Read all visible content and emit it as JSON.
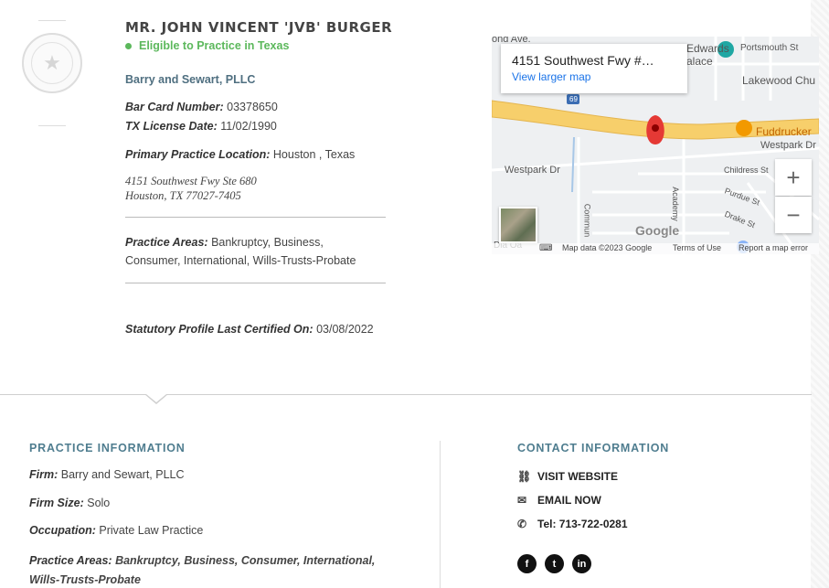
{
  "profile": {
    "name": "MR. JOHN VINCENT 'JVB' BURGER",
    "eligibility": "Eligible to Practice in Texas",
    "firm": "Barry and Sewart, PLLC",
    "bar_card_label": "Bar Card Number:",
    "bar_card_value": "03378650",
    "license_label": "TX License Date:",
    "license_value": "11/02/1990",
    "location_label": "Primary Practice Location:",
    "location_value": "Houston , Texas",
    "address_line1": "4151 Southwest Fwy Ste 680",
    "address_line2": "Houston, TX 77027-7405",
    "areas_label": "Practice Areas:",
    "areas_value": "Bankruptcy, Business, Consumer, International, Wills-Trusts-Probate",
    "certified_label": "Statutory Profile Last Certified On:",
    "certified_value": "03/08/2022"
  },
  "map": {
    "card_address": "4151 Southwest Fwy #…",
    "larger_map": "View larger map",
    "zoom_in": "+",
    "zoom_out": "−",
    "google": "Google",
    "footer_data": "Map data ©2023 Google",
    "footer_terms": "Terms of Use",
    "footer_report": "Report a map error",
    "labels": {
      "portsmouth": "Portsmouth St",
      "lakewood": "Lakewood Chu",
      "fuddruckers": "Fuddrucker",
      "westpark_dr_right": "Westpark Dr",
      "westpark_dr_left": "Westpark Dr",
      "childress": "Childress St",
      "purdue": "Purdue St",
      "drake": "Drake St",
      "academy": "Academy",
      "commun": "Commun",
      "ond_ave": "ond Ave.",
      "edwards": "Edwards",
      "palace": "alace",
      "route": "69",
      "bottom_left": "Dia Oa"
    }
  },
  "practice": {
    "title": "PRACTICE INFORMATION",
    "firm_label": "Firm:",
    "firm_value": "Barry and Sewart, PLLC",
    "size_label": "Firm Size:",
    "size_value": "Solo",
    "occupation_label": "Occupation:",
    "occupation_value": "Private Law Practice",
    "areas_label": "Practice Areas:",
    "areas_value": "Bankruptcy, Business, Consumer, International, Wills-Trusts-Probate"
  },
  "contact": {
    "title": "CONTACT INFORMATION",
    "website": "VISIT WEBSITE",
    "email": "EMAIL NOW",
    "phone": "Tel: 713-722-0281"
  },
  "social": {
    "facebook": "f",
    "twitter": "t",
    "linkedin": "in"
  },
  "colors": {
    "eligible": "#5cb85c",
    "accent": "#4f7d8f",
    "link": "#1a73e8",
    "map_pin": "#e53935",
    "highway": "#f7cf6b"
  }
}
